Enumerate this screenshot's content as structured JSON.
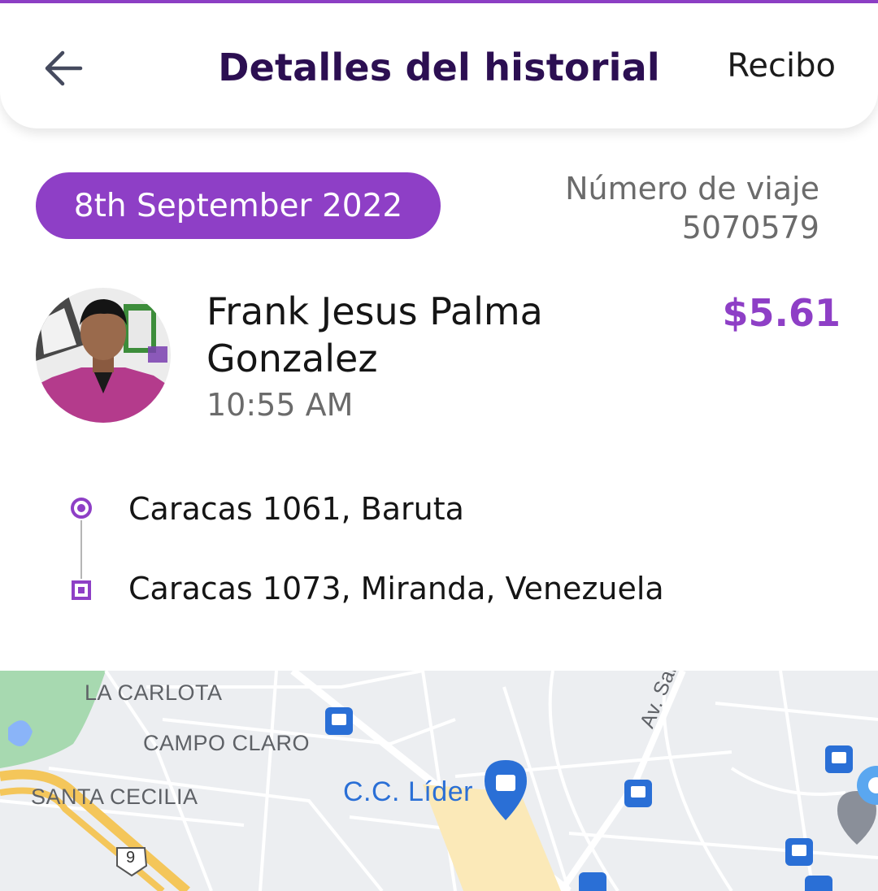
{
  "header": {
    "title": "Detalles del historial",
    "receipt_label": "Recibo",
    "back_icon": "arrow-left-icon"
  },
  "trip": {
    "date": "8th September 2022",
    "number_label": "Número de viaje",
    "number": "5070579"
  },
  "driver": {
    "name": "Frank Jesus Palma Gonzalez",
    "time": "10:55 AM",
    "price": "$5.61"
  },
  "route": {
    "origin": "Caracas 1061, Baruta",
    "destination": "Caracas 1073, Miranda, Venezuela"
  },
  "map": {
    "labels": {
      "la_carlota": "LA CARLOTA",
      "campo_claro": "CAMPO CLARO",
      "santa_cecilia": "SANTA CECILIA",
      "cc_lider": "C.C. Líder",
      "av_sanz": "Av. Sanz",
      "route_shield": "9"
    }
  },
  "colors": {
    "accent": "#8e3fc6",
    "title": "#2c0f52",
    "muted_text": "#6b6b6b"
  }
}
